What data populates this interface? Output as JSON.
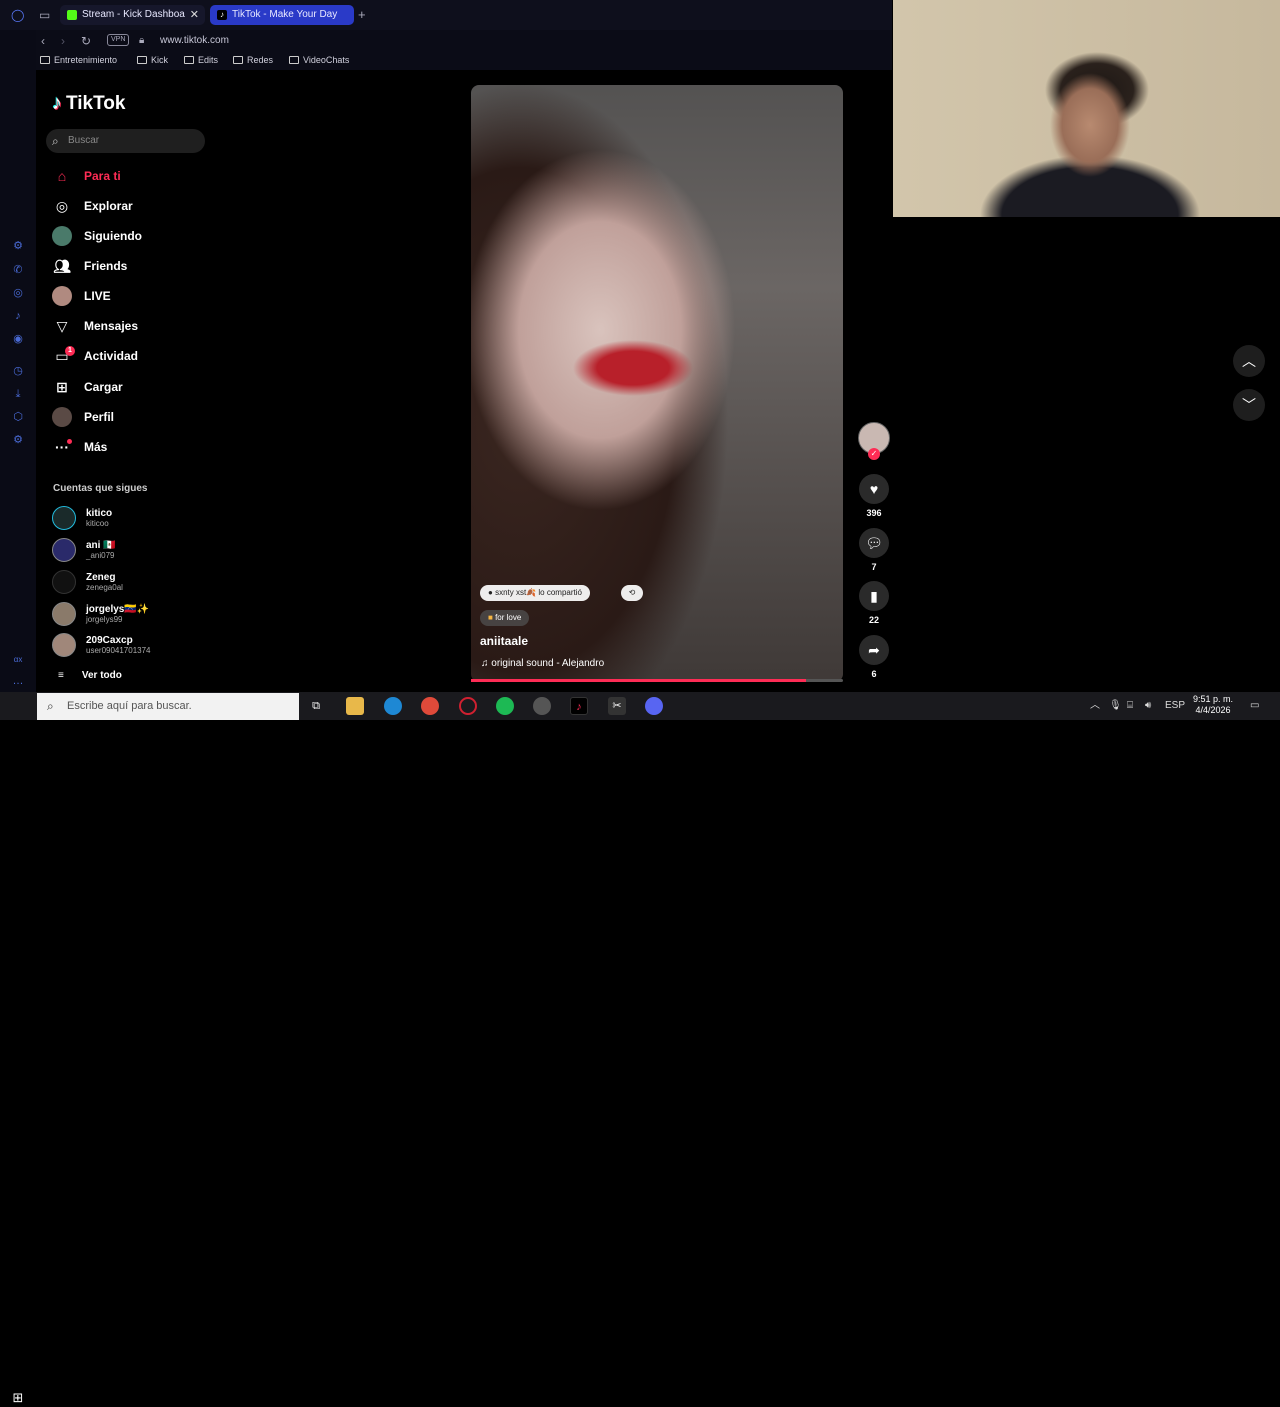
{
  "browser": {
    "tabs": [
      {
        "label": "Stream - Kick Dashboa",
        "favicon_color": "#53fc18"
      },
      {
        "label": "TikTok - Make Your Day",
        "favicon_color": "#000000"
      }
    ],
    "address": "www.tiktok.com",
    "vpn_label": "VPN",
    "bookmarks": [
      "Entretenimiento",
      "Kick",
      "Edits",
      "Redes",
      "VideoChats"
    ]
  },
  "tiktok": {
    "logo_text": "TikTok",
    "search_placeholder": "Buscar",
    "nav": [
      {
        "label": "Para ti",
        "icon": "home-icon"
      },
      {
        "label": "Explorar",
        "icon": "compass-icon"
      },
      {
        "label": "Siguiendo",
        "icon": "following-icon"
      },
      {
        "label": "Friends",
        "icon": "friends-icon"
      },
      {
        "label": "LIVE",
        "icon": "live-icon"
      },
      {
        "label": "Mensajes",
        "icon": "messages-icon"
      },
      {
        "label": "Actividad",
        "icon": "activity-icon",
        "badge": "1"
      },
      {
        "label": "Cargar",
        "icon": "upload-icon"
      },
      {
        "label": "Perfil",
        "icon": "profile-icon"
      },
      {
        "label": "Más",
        "icon": "more-icon"
      }
    ],
    "following_title": "Cuentas que sigues",
    "following": [
      {
        "name": "kitico",
        "handle": "kiticoo"
      },
      {
        "name": "ani 🇲🇽",
        "handle": "_ani079"
      },
      {
        "name": "Zeneg",
        "handle": "zenega0al"
      },
      {
        "name": "jorgelys🇻🇪✨",
        "handle": "jorgelys99"
      },
      {
        "name": "209Caxcp",
        "handle": "user09041701374"
      }
    ],
    "see_all": "Ver todo"
  },
  "video": {
    "shared_chip": "sxnty xst🍂 lo compartió",
    "tag_chip": "for love",
    "username": "aniitaale",
    "sound": "original sound - Alejandro",
    "progress_percent": 90,
    "likes": "396",
    "comments": "7",
    "saves": "22",
    "shares": "6"
  },
  "taskbar": {
    "search_placeholder": "Escribe aquí para buscar.",
    "language": "ESP",
    "time": "9:51 p. m.",
    "date": "4/4/2026"
  }
}
